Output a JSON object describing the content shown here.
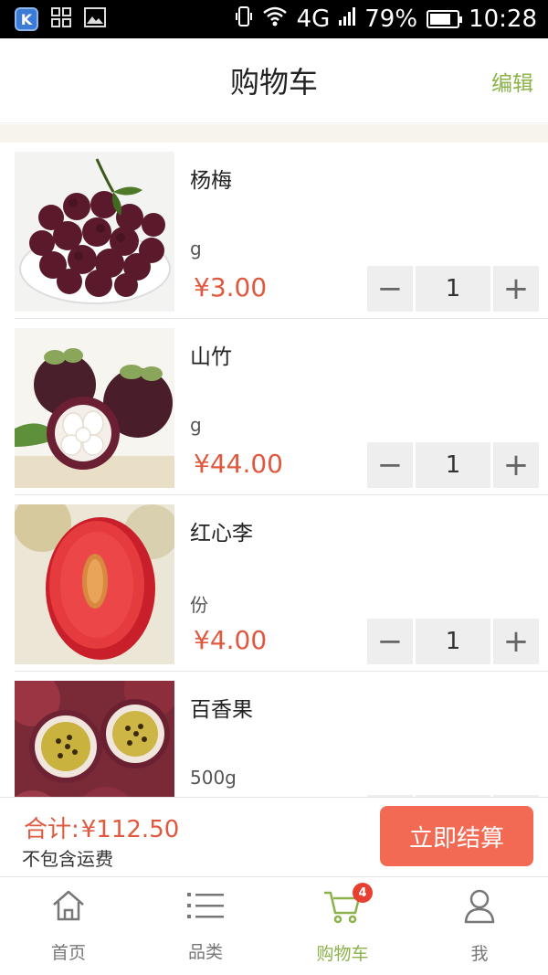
{
  "status_bar": {
    "signal": "4G",
    "battery": "79%",
    "battery_level": 0.79,
    "time": "10:28",
    "app_badge_letter": "K"
  },
  "header": {
    "title": "购物车",
    "edit_label": "编辑"
  },
  "items": [
    {
      "name": "杨梅",
      "unit": "g",
      "price": "¥3.00",
      "qty": "1"
    },
    {
      "name": "山竹",
      "unit": "g",
      "price": "¥44.00",
      "qty": "1"
    },
    {
      "name": "红心李",
      "unit": "份",
      "price": "¥4.00",
      "qty": "1"
    },
    {
      "name": "百香果",
      "unit": "500g",
      "price": "",
      "qty": ""
    }
  ],
  "stepper": {
    "minus": "−",
    "plus": "+"
  },
  "footer": {
    "total_prefix": "合计:",
    "total_value": "¥112.50",
    "shipping_note": "不包含运费",
    "checkout_label": "立即结算"
  },
  "tabs": [
    {
      "label": "首页",
      "icon": "home-icon"
    },
    {
      "label": "品类",
      "icon": "list-icon"
    },
    {
      "label": "购物车",
      "icon": "cart-icon",
      "badge": "4",
      "active": true
    },
    {
      "label": "我",
      "icon": "user-icon"
    }
  ],
  "colors": {
    "accent": "#8bb24a",
    "price": "#e0583e",
    "checkout": "#f36a54",
    "badge": "#e84030"
  }
}
